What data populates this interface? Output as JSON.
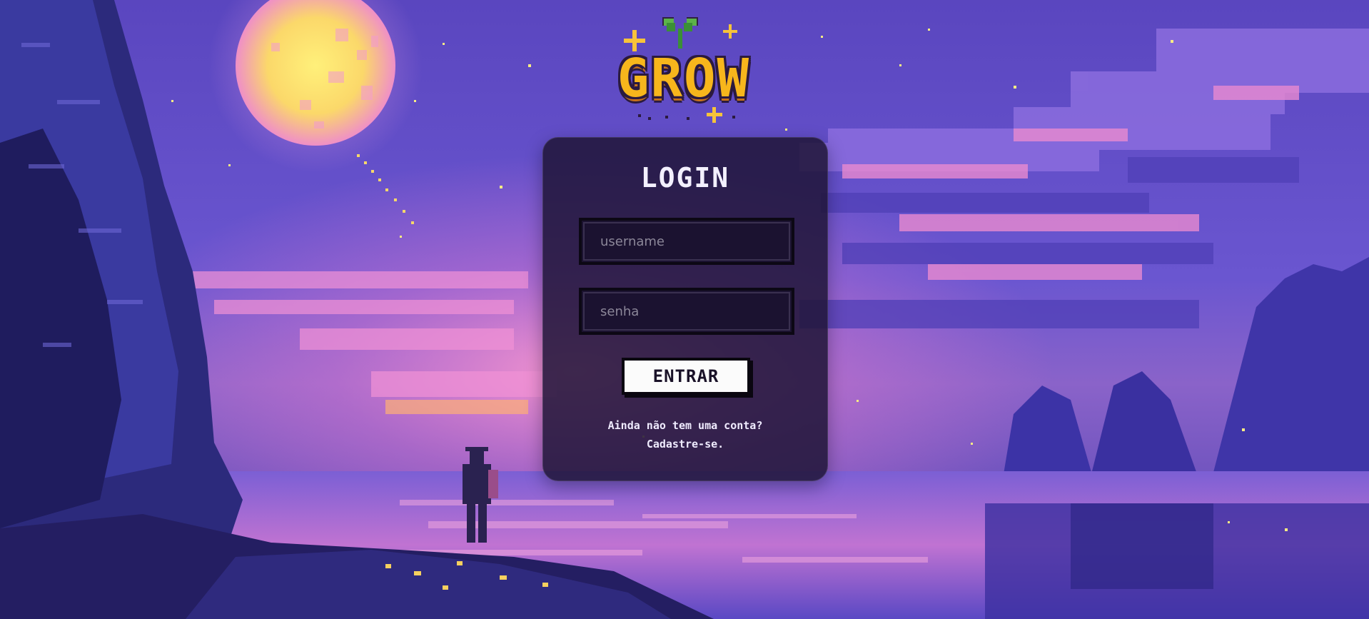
{
  "logo": {
    "text": "GROW"
  },
  "login": {
    "title": "LOGIN",
    "username_placeholder": "username",
    "password_placeholder": "senha",
    "submit_label": "ENTRAR",
    "signup_line1": "Ainda não tem uma conta?",
    "signup_line2": "Cadastre-se."
  },
  "colors": {
    "logo_yellow": "#f7b61c",
    "sky_purple": "#5f4fc4",
    "card_bg": "#201538",
    "button_bg": "#fbfbfb",
    "moon": "#fbe36a"
  }
}
